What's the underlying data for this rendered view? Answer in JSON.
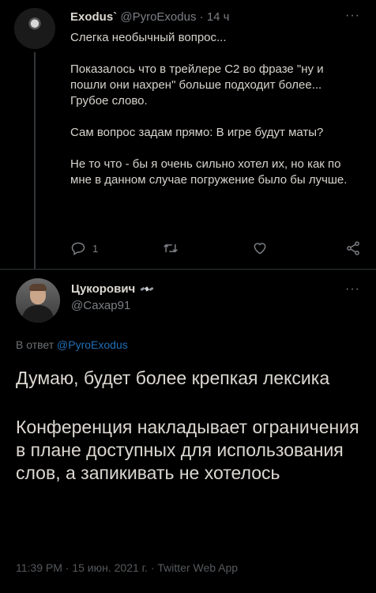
{
  "tweet1": {
    "display_name": "Exodus`",
    "handle": "@PyroExodus",
    "separator": "·",
    "time": "14 ч",
    "more": "···",
    "paragraphs": [
      "Слегка необычный вопрос...",
      "Показалось что в трейлере С2 во фразе \"ну и пошли они нахрен\" больше подходит более... Грубое слово.",
      "Сам вопрос задам прямо: В игре будут маты?",
      "Не то что - бы я очень сильно хотел их, но как по мне в данном случае погружение было бы лучше."
    ],
    "actions": {
      "reply_count": "1",
      "retweet_count": "",
      "like_count": ""
    }
  },
  "tweet2": {
    "display_name": "Цукорович",
    "handle": "@Сахар91",
    "more": "···",
    "reply_prefix": "В ответ",
    "reply_handle": "@PyroExodus",
    "paragraphs": [
      "Думаю, будет более крепкая лексика",
      "Конференция накладывает ограничения в плане доступных для использования слов, а запикивать не хотелось"
    ],
    "footer": "11:39 PM · 15 июн. 2021 г. · Twitter Web App"
  },
  "colors": {
    "background": "#000000",
    "text": "#e7e3dd",
    "muted": "#7b7f84",
    "link": "#1f6fb8",
    "divider": "#2f3336"
  }
}
